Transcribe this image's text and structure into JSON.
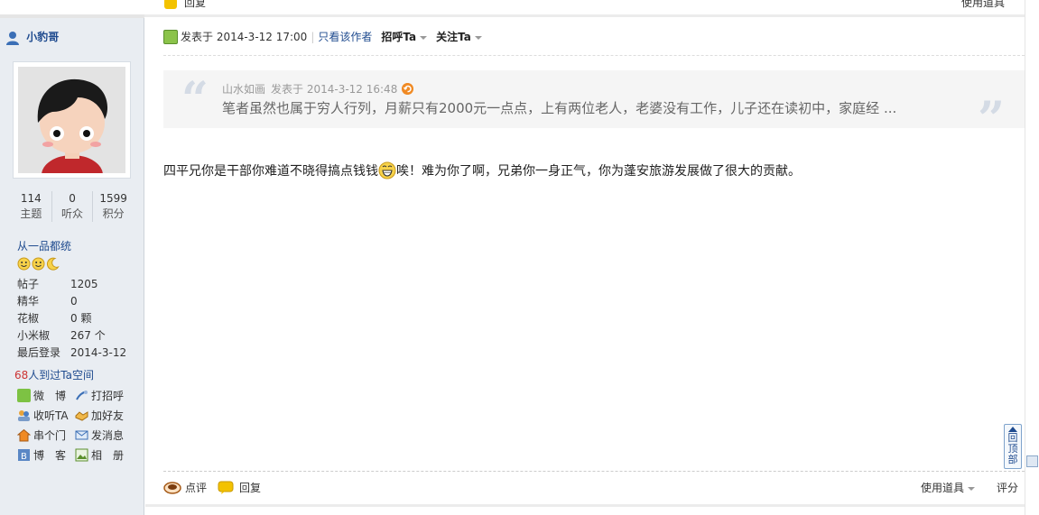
{
  "prev_footer": {
    "reply_label": "回复",
    "tools_label": "使用道具"
  },
  "user": {
    "name": "小豹哥",
    "stats": [
      {
        "num": "114",
        "label": "主题"
      },
      {
        "num": "0",
        "label": "听众"
      },
      {
        "num": "1599",
        "label": "积分"
      }
    ],
    "group": "从一品都统",
    "info": [
      {
        "k": "帖子",
        "v": "1205"
      },
      {
        "k": "精华",
        "v": "0"
      },
      {
        "k": "花椒",
        "v": "0 颗"
      },
      {
        "k": "小米椒",
        "v": "267 个"
      },
      {
        "k": "最后登录",
        "v": "2014-3-12"
      }
    ],
    "visits_num": "68",
    "visits_text": "人到过Ta空间",
    "actions": [
      "微　博",
      "打招呼",
      "收听TA",
      "加好友",
      "串个门",
      "发消息",
      "博　客",
      "相　册"
    ]
  },
  "post": {
    "posted_label": "发表于 2014-3-12 17:00",
    "only_author": "只看该作者",
    "greet": "招呼Ta",
    "follow": "关注Ta",
    "quote": {
      "author": "山水如画",
      "posted": "发表于 2014-3-12 16:48",
      "text": "笔者虽然也属于穷人行列，月薪只有2000元一点点，上有两位老人，老婆没有工作，儿子还在读初中，家庭经 ..."
    },
    "content_before": "四平兄你是干部你难道不晓得搞点钱钱",
    "content_after": "唉！难为你了啊，兄弟你一身正气，你为蓬安旅游发展做了很大的贡献。"
  },
  "footer": {
    "rate": "点评",
    "reply": "回复",
    "tools": "使用道具",
    "score": "评分"
  },
  "totop_label": "回顶部",
  "colors": {
    "link": "#1f4b8f",
    "sidebar_bg": "#e9edf2",
    "quote_bg": "#f5f5f5"
  }
}
